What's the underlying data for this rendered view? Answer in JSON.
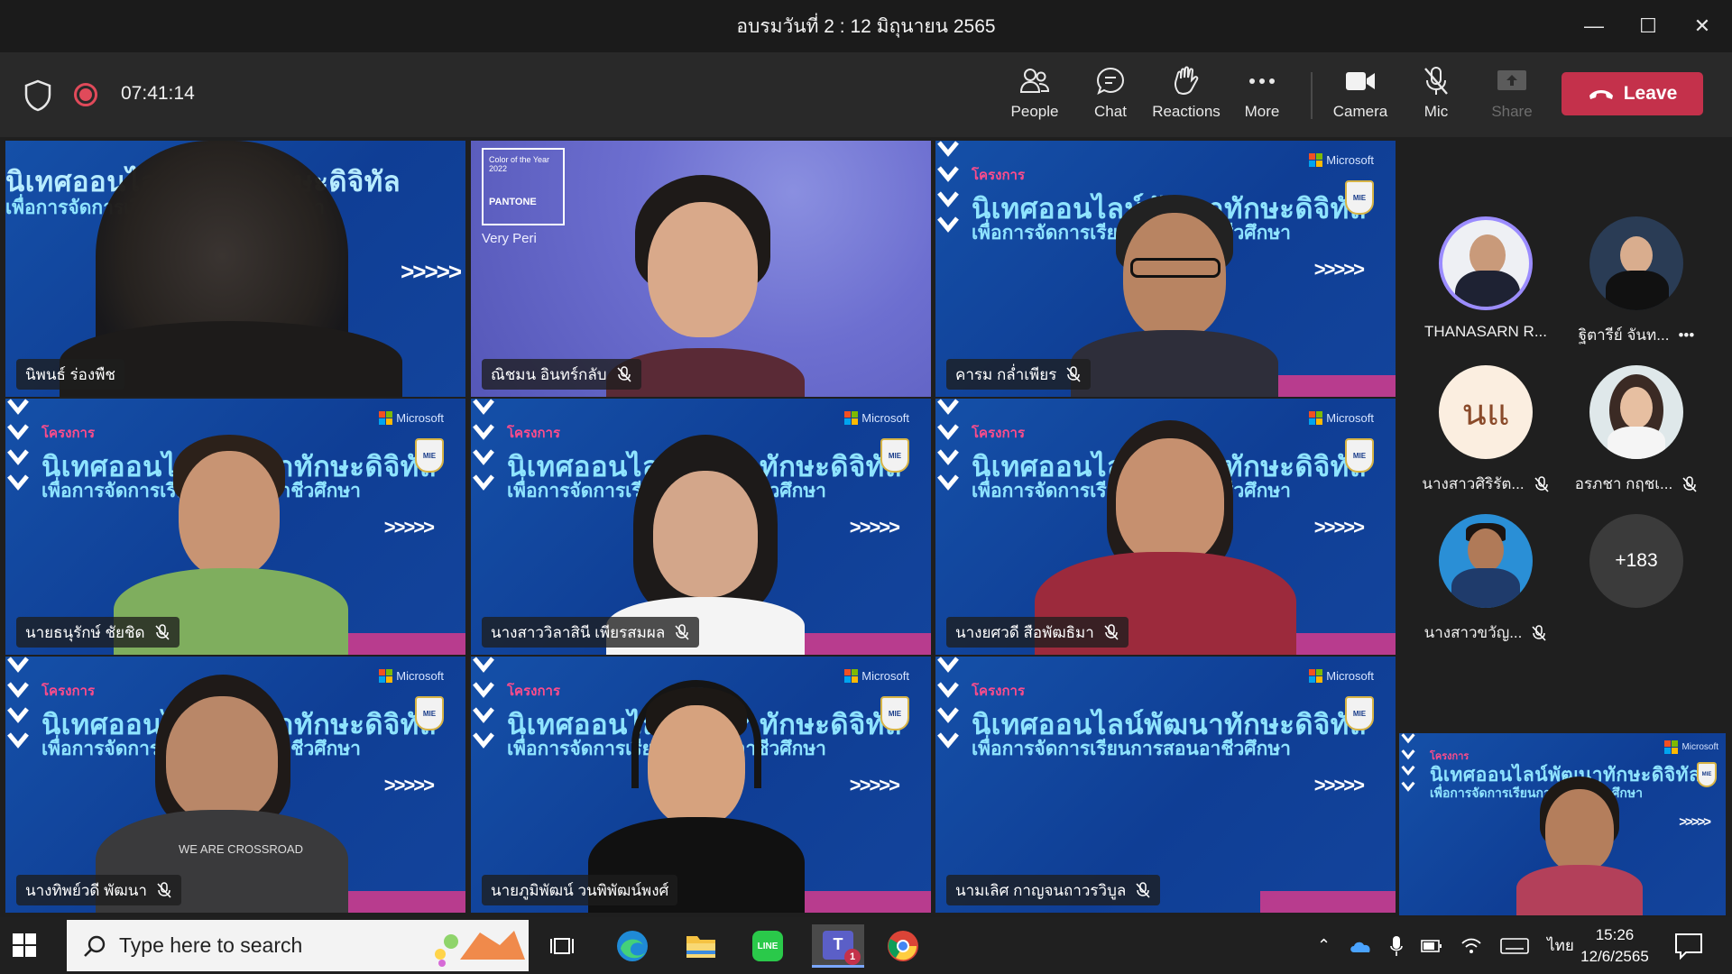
{
  "window": {
    "title": "อบรมวันที่ 2 : 12 มิถุนายน 2565",
    "controls": {
      "minimize": "—",
      "maximize": "☐",
      "close": "✕"
    }
  },
  "toolbar": {
    "timer": "07:41:14",
    "buttons": {
      "people": "People",
      "chat": "Chat",
      "reactions": "Reactions",
      "more": "More",
      "camera": "Camera",
      "mic": "Mic",
      "share": "Share"
    },
    "leave": "Leave",
    "leave_color": "#c4314b",
    "recording_color": "#e04a5a"
  },
  "banner": {
    "line1": "โครงการ",
    "line2": "นิเทศออนไลน์พัฒนาทักษะดิจิทัล",
    "line3": "เพื่อการจัดการเรียนการสอนอาชีวศึกษา",
    "arrows": ">>>>>",
    "badge": "MIE",
    "microsoft": "Microsoft"
  },
  "video_tiles": [
    {
      "name": "นิพนธ์ ร่องพืช",
      "muted": false
    },
    {
      "name": "ณิชมน อินทร์กลับ",
      "muted": true
    },
    {
      "name": "คารม กล่ำเพียร",
      "muted": true
    },
    {
      "name": "นายธนุรักษ์ ชัยชิด",
      "muted": true
    },
    {
      "name": "นางสาววิลาสินี เพียรสมผล",
      "muted": true
    },
    {
      "name": "นางยศวดี สือพัฒธิมา",
      "muted": true
    },
    {
      "name": "นางทิพย์วดี พัฒนา",
      "muted": true
    },
    {
      "name": "นายภูมิพัฒน์ วนพิพัฒน์พงศ์",
      "muted": false
    },
    {
      "name": "นามเลิศ กาญจนถาวรวิบูล",
      "muted": true
    }
  ],
  "tile_texts": {
    "pantone_small": "Color of the Year 2022",
    "pantone": "PANTONE",
    "very_peri": "Very Peri",
    "shirt": "WE ARE CROSSROAD"
  },
  "participants": [
    {
      "name": "THANASARN R...",
      "muted": false,
      "speaking": true
    },
    {
      "name": "ฐิตารีย์ จันท...",
      "muted": false,
      "more": "•••"
    },
    {
      "name": "นางสาวศิริรัต...",
      "muted": true,
      "initials": "นแ"
    },
    {
      "name": "อรภชา กฤชเ...",
      "muted": true
    },
    {
      "name": "นางสาวขวัญ...",
      "muted": true
    }
  ],
  "overflow_count": "+183",
  "taskbar": {
    "search_placeholder": "Type here to search",
    "teams_badge": "1",
    "language": "ไทย",
    "time": "15:26",
    "date": "12/6/2565"
  }
}
